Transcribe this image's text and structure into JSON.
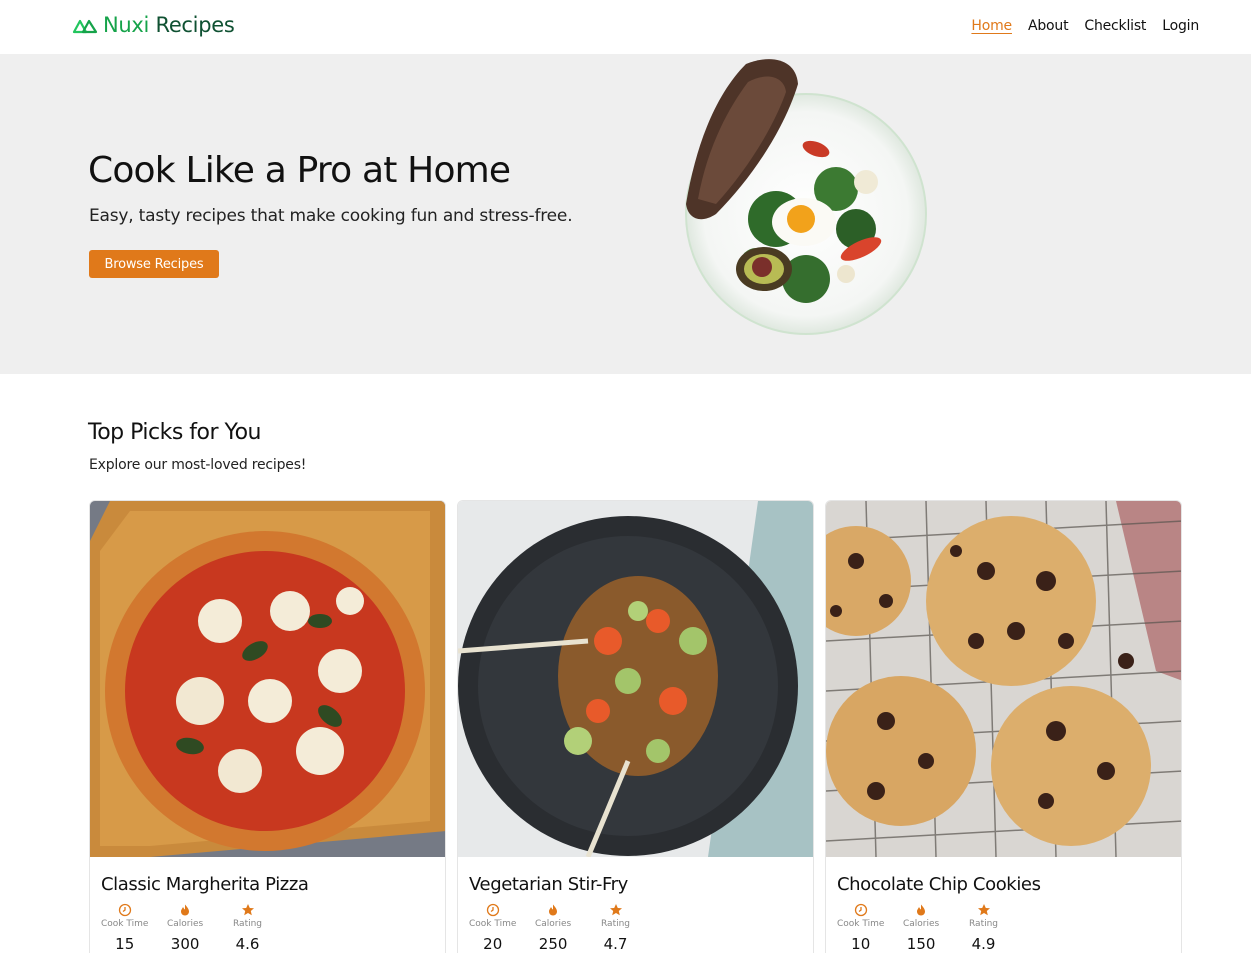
{
  "header": {
    "brand_first": "Nuxi",
    "brand_second": " Recipes",
    "nav": [
      {
        "label": "Home",
        "active": true
      },
      {
        "label": "About",
        "active": false
      },
      {
        "label": "Checklist",
        "active": false
      },
      {
        "label": "Login",
        "active": false
      }
    ]
  },
  "hero": {
    "title": "Cook Like a Pro at Home",
    "subtitle": "Easy, tasty recipes that make cooking fun and stress-free.",
    "button_label": "Browse Recipes"
  },
  "section": {
    "title": "Top Picks for You",
    "subtitle": "Explore our most-loved recipes!"
  },
  "stat_labels": {
    "cook_time": "Cook Time",
    "calories": "Calories",
    "rating": "Rating"
  },
  "recipes": [
    {
      "title": "Classic Margherita Pizza",
      "cook_time": "15",
      "calories": "300",
      "rating": "4.6"
    },
    {
      "title": "Vegetarian Stir-Fry",
      "cook_time": "20",
      "calories": "250",
      "rating": "4.7"
    },
    {
      "title": "Chocolate Chip Cookies",
      "cook_time": "10",
      "calories": "150",
      "rating": "4.9"
    }
  ],
  "colors": {
    "accent": "#e0791a",
    "brand_green": "#16a34a",
    "hero_bg": "#efefef"
  }
}
